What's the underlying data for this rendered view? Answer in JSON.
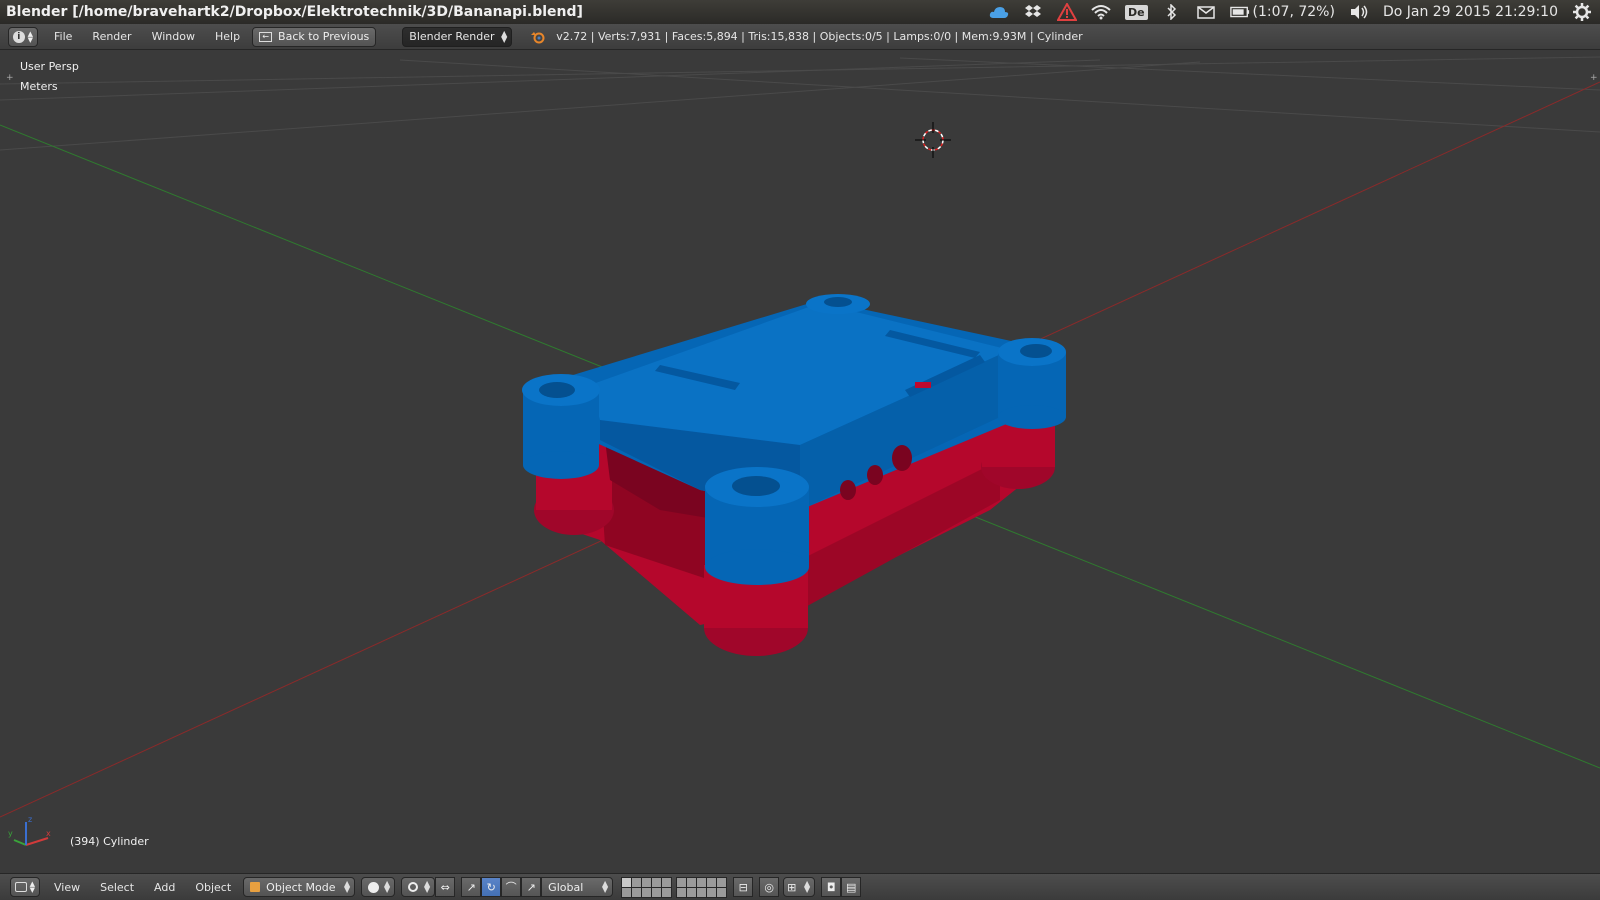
{
  "os": {
    "window_title": "Blender [/home/bravehartk2/Dropbox/Elektrotechnik/3D/Bananapi.blend]",
    "keyboard_layout": "De",
    "battery": "(1:07, 72%)",
    "datetime": "Do Jan 29 2015 21:29:10"
  },
  "header": {
    "menu": [
      "File",
      "Render",
      "Window",
      "Help"
    ],
    "back_button": "Back to Previous",
    "render_engine": "Blender Render",
    "stats": "v2.72 | Verts:7,931 | Faces:5,894 | Tris:15,838 | Objects:0/5 | Lamps:0/0 | Mem:9.93M | Cylinder"
  },
  "viewport": {
    "view_name": "User Persp",
    "units": "Meters",
    "object_info": "(394) Cylinder",
    "axis_x": "x",
    "axis_y": "y",
    "axis_z": "z"
  },
  "footer": {
    "menu": [
      "View",
      "Select",
      "Add",
      "Object"
    ],
    "mode": "Object Mode",
    "orientation": "Global"
  },
  "colors": {
    "case_top": "#0566b5",
    "case_bottom": "#b5072c",
    "x_axis_line": "#8a2a2a",
    "y_axis_line": "#2f7a2f"
  }
}
